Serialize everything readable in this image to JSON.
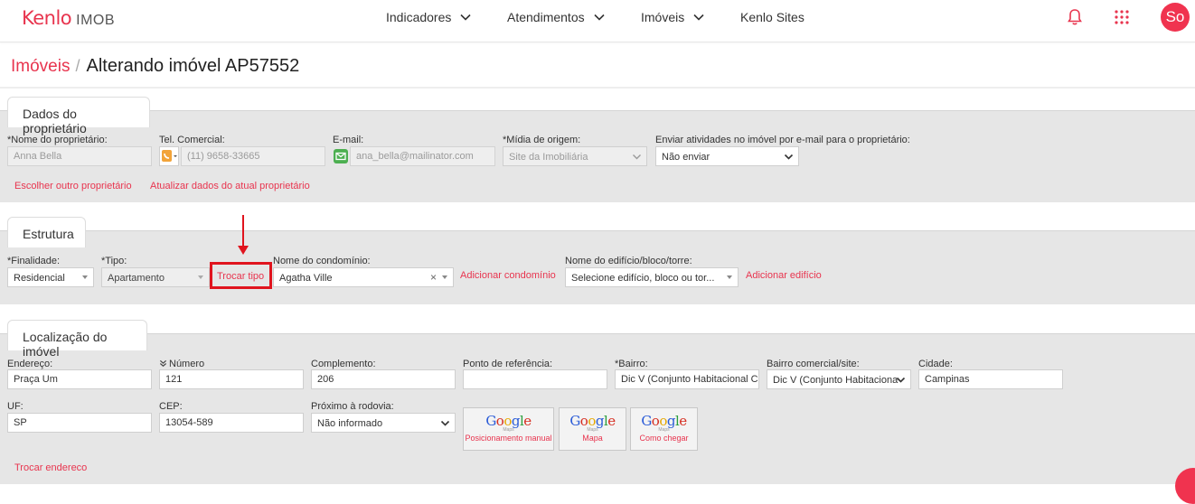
{
  "brand": {
    "logo_main": "Kenlo",
    "logo_sub": "IMOB"
  },
  "nav": {
    "items": [
      {
        "label": "Indicadores"
      },
      {
        "label": "Atendimentos"
      },
      {
        "label": "Imóveis"
      },
      {
        "label": "Kenlo Sites"
      }
    ],
    "avatar_initials": "So"
  },
  "breadcrumb": {
    "link": "Imóveis",
    "separator": "/",
    "title": "Alterando imóvel AP57552"
  },
  "owner": {
    "section_title": "Dados do proprietário",
    "name_label": "*Nome do proprietário:",
    "name_value": "Anna Bella",
    "phone_label": "Tel. Comercial:",
    "phone_value": "(11) 9658-33665",
    "email_label": "E-mail:",
    "email_value": "ana_bella@mailinator.com",
    "media_label": "*Mídia de origem:",
    "media_value": "Site da Imobiliária",
    "send_label": "Enviar atividades no imóvel por e-mail para o proprietário:",
    "send_value": "Não enviar",
    "choose_other": "Escolher outro proprietário",
    "update_current": "Atualizar dados do atual proprietário"
  },
  "structure": {
    "section_title": "Estrutura",
    "purpose_label": "*Finalidade:",
    "purpose_value": "Residencial",
    "type_label": "*Tipo:",
    "type_value": "Apartamento",
    "change_type": "Trocar tipo",
    "condo_label": "Nome do condomínio:",
    "condo_value": "Agatha Ville",
    "add_condo": "Adicionar condomínio",
    "building_label": "Nome do edifício/bloco/torre:",
    "building_placeholder": "Selecione edifício, bloco ou tor...",
    "add_building": "Adicionar edifício"
  },
  "location": {
    "section_title": "Localização do imóvel",
    "address_label": "Endereço:",
    "address_value": "Praça Um",
    "number_label": "Número",
    "number_value": "121",
    "complement_label": "Complemento:",
    "complement_value": "206",
    "reference_label": "Ponto de referência:",
    "reference_value": "",
    "district_label": "*Bairro:",
    "district_value": "Dic V (Conjunto Habitacional Chi",
    "commercial_district_label": "Bairro comercial/site:",
    "commercial_district_value": "Dic V (Conjunto Habitaciona",
    "city_label": "Cidade:",
    "city_value": "Campinas",
    "state_label": "UF:",
    "state_value": "SP",
    "zip_label": "CEP:",
    "zip_value": "13054-589",
    "highway_label": "Próximo à rodovia:",
    "highway_value": "Não informado",
    "google_word": "Google",
    "google_sub": "Maps",
    "google_buttons": [
      {
        "caption": "Posicionamento manual"
      },
      {
        "caption": "Mapa"
      },
      {
        "caption": "Como chegar"
      }
    ],
    "change_address": "Trocar endereco"
  },
  "colors": {
    "accent": "#e8344e",
    "panel_bg": "#e6e6e6",
    "annotation": "#e0141e"
  }
}
